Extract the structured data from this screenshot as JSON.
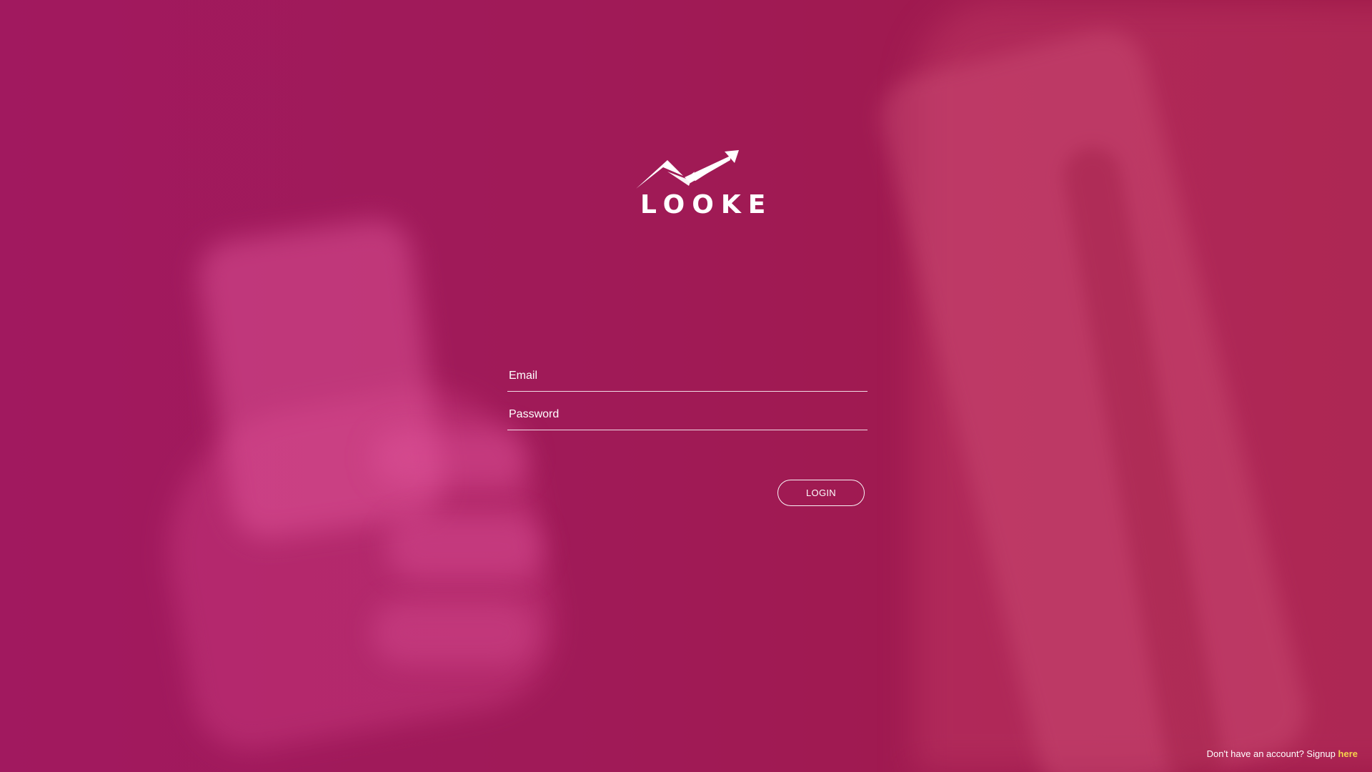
{
  "brand": {
    "name": "LOOKE",
    "logo_icon": "rising-arrow-mountain-logo"
  },
  "form": {
    "email_placeholder": "Email",
    "password_placeholder": "Password",
    "email_value": "",
    "password_value": "",
    "login_label": "LOGIN"
  },
  "footer": {
    "signup_text": "Don't have an account? Signup ",
    "signup_link": "here"
  },
  "colors": {
    "background": "#a01a57",
    "text": "#ffffff",
    "link_accent": "#f7d44c"
  }
}
